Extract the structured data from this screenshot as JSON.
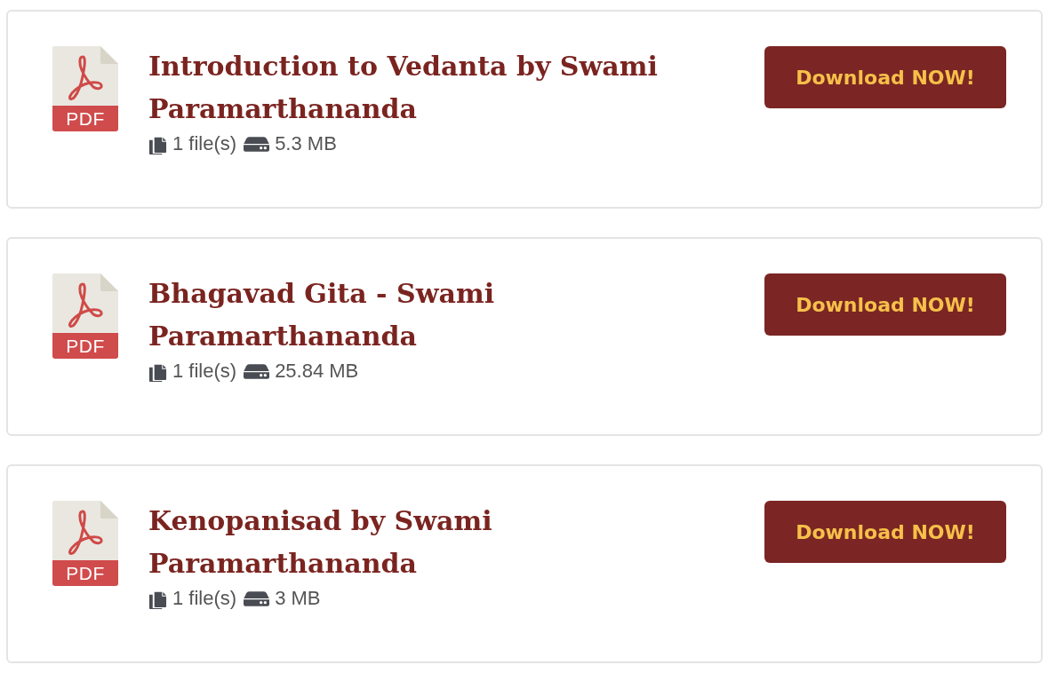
{
  "files": [
    {
      "title": "Introduction to Vedanta by Swami Paramarthananda",
      "file_type": "PDF",
      "file_count": "1 file(s)",
      "size": "5.3 MB",
      "button": "Download NOW!"
    },
    {
      "title": "Bhagavad Gita - Swami Paramarthananda",
      "file_type": "PDF",
      "file_count": "1 file(s)",
      "size": "25.84 MB",
      "button": "Download NOW!"
    },
    {
      "title": "Kenopanisad by Swami Paramarthananda",
      "file_type": "PDF",
      "file_count": "1 file(s)",
      "size": "3 MB",
      "button": "Download NOW!"
    }
  ]
}
